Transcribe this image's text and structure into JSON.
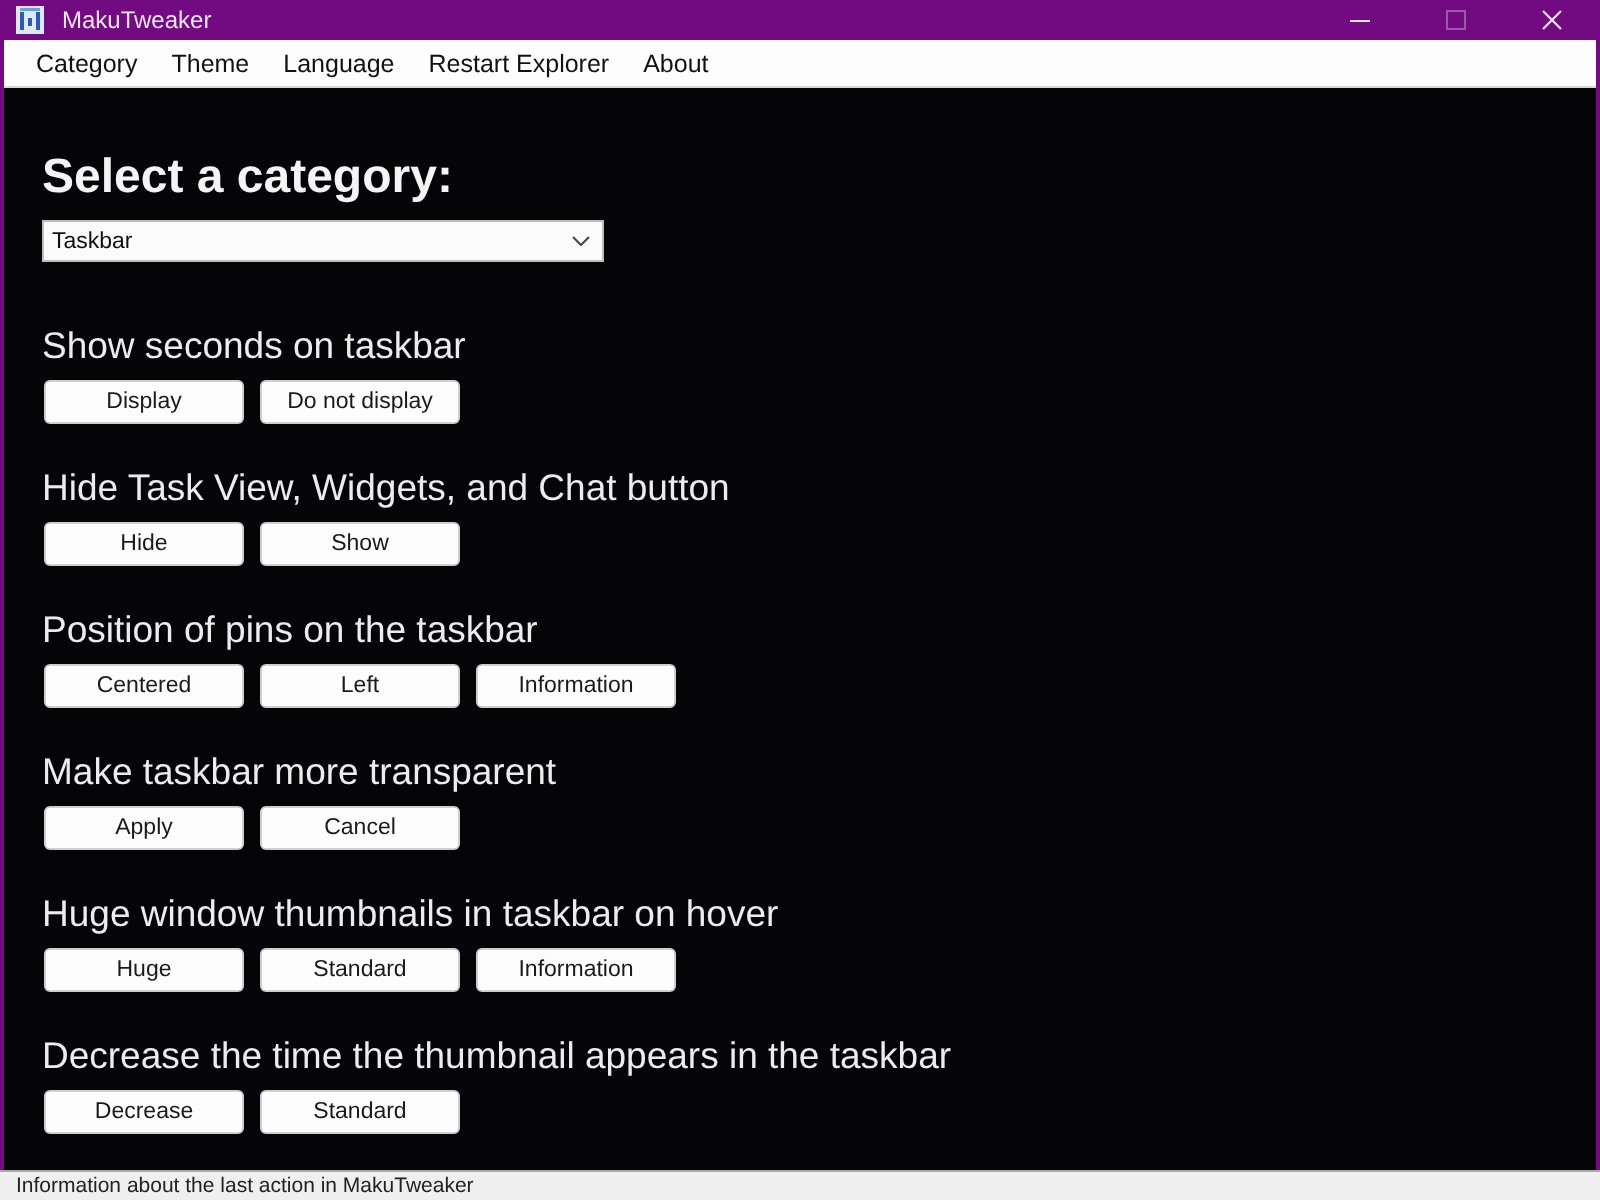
{
  "window": {
    "title": "MakuTweaker",
    "controls": [
      {
        "kind": "minimize",
        "disabled": false
      },
      {
        "kind": "maximize",
        "disabled": true
      },
      {
        "kind": "close",
        "disabled": false
      }
    ]
  },
  "menu": [
    "Category",
    "Theme",
    "Language",
    "Restart Explorer",
    "About"
  ],
  "heading": "Select a category:",
  "category_select": {
    "value": "Taskbar"
  },
  "settings": [
    {
      "label": "Show seconds on taskbar",
      "buttons": [
        "Display",
        "Do not display"
      ]
    },
    {
      "label": "Hide Task View, Widgets, and Chat button",
      "buttons": [
        "Hide",
        "Show"
      ]
    },
    {
      "label": "Position of pins on the taskbar",
      "buttons": [
        "Centered",
        "Left",
        "Information"
      ]
    },
    {
      "label": "Make taskbar more transparent",
      "buttons": [
        "Apply",
        "Cancel"
      ]
    },
    {
      "label": "Huge window thumbnails in taskbar on hover",
      "buttons": [
        "Huge",
        "Standard",
        "Information"
      ]
    },
    {
      "label": "Decrease the time the thumbnail appears in the taskbar",
      "buttons": [
        "Decrease",
        "Standard"
      ]
    }
  ],
  "status_bar": "Information about the last action in MakuTweaker"
}
